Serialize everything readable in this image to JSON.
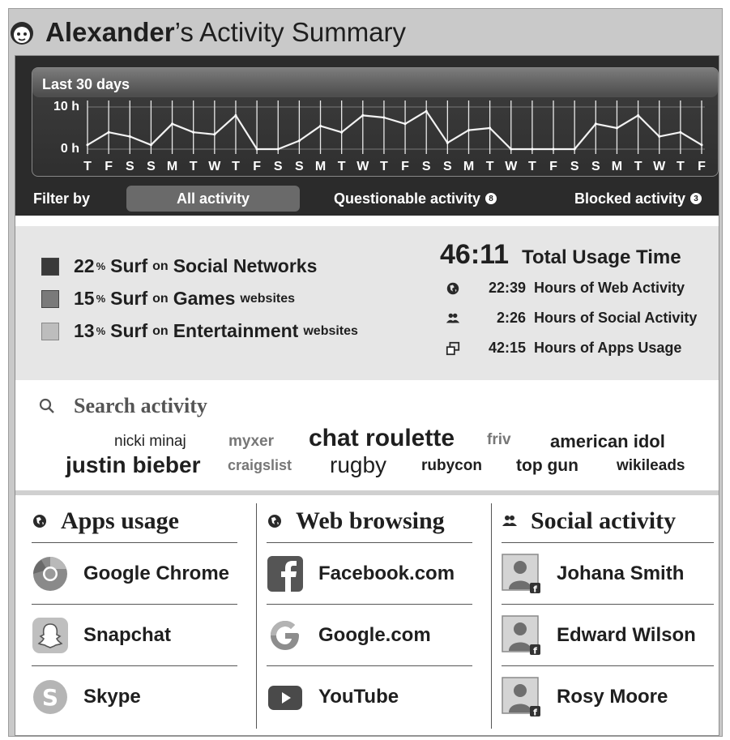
{
  "title": {
    "name": "Alexander",
    "suffix": "’s Activity Summary"
  },
  "chart": {
    "period": "Last 30 days",
    "y_top": "10 h",
    "y_bottom": "0 h",
    "days": [
      "T",
      "F",
      "S",
      "S",
      "M",
      "T",
      "W",
      "T",
      "F",
      "S",
      "S",
      "M",
      "T",
      "W",
      "T",
      "F",
      "S",
      "S",
      "M",
      "T",
      "W",
      "T",
      "F",
      "S",
      "S",
      "M",
      "T",
      "W",
      "T",
      "F"
    ]
  },
  "chart_data": {
    "type": "line",
    "xlabel": "",
    "ylabel": "",
    "ylim": [
      0,
      10
    ],
    "x": [
      "T",
      "F",
      "S",
      "S",
      "M",
      "T",
      "W",
      "T",
      "F",
      "S",
      "S",
      "M",
      "T",
      "W",
      "T",
      "F",
      "S",
      "S",
      "M",
      "T",
      "W",
      "T",
      "F",
      "S",
      "S",
      "M",
      "T",
      "W",
      "T",
      "F"
    ],
    "values": [
      1,
      4,
      3,
      1,
      6,
      4,
      3.5,
      8,
      0,
      0,
      2,
      5.5,
      4,
      8,
      7.5,
      6,
      9,
      1.5,
      4.5,
      5,
      0,
      0,
      0,
      0,
      6,
      5,
      8,
      3,
      4,
      1
    ]
  },
  "filter": {
    "label": "Filter by",
    "all": "All activity",
    "questionable": "Questionable activity",
    "questionable_count": "8",
    "blocked": "Blocked activity",
    "blocked_count": "3"
  },
  "categories": [
    {
      "pct": "22",
      "pct_sign": "%",
      "surf": "Surf",
      "on": "on",
      "name": "Social Networks",
      "suffix": "",
      "color": "#3a3a3a"
    },
    {
      "pct": "15",
      "pct_sign": "%",
      "surf": "Surf",
      "on": "on",
      "name": "Games",
      "suffix": "websites",
      "color": "#7a7a7a"
    },
    {
      "pct": "13",
      "pct_sign": "%",
      "surf": "Surf",
      "on": "on",
      "name": "Entertainment",
      "suffix": "websites",
      "color": "#bdbdbd"
    }
  ],
  "usage": {
    "total": "46:11",
    "total_label": "Total Usage Time",
    "rows": [
      {
        "icon": "globe-icon",
        "value": "22:39",
        "label": "Hours of Web Activity"
      },
      {
        "icon": "people-icon",
        "value": "2:26",
        "label": "Hours of Social Activity"
      },
      {
        "icon": "windows-icon",
        "value": "42:15",
        "label": "Hours of Apps Usage"
      }
    ]
  },
  "search": {
    "title": "Search activity",
    "terms": [
      "nicki minaj",
      "myxer",
      "chat roulette",
      "friv",
      "american idol",
      "justin bieber",
      "craigslist",
      "rugby",
      "rubycon",
      "top gun",
      "wikileads"
    ]
  },
  "apps": {
    "title": "Apps usage",
    "items": [
      "Google Chrome",
      "Snapchat",
      "Skype"
    ]
  },
  "web": {
    "title": "Web browsing",
    "items": [
      "Facebook.com",
      "Google.com",
      "YouTube"
    ]
  },
  "social": {
    "title": "Social activity",
    "items": [
      "Johana Smith",
      "Edward Wilson",
      "Rosy Moore"
    ]
  }
}
